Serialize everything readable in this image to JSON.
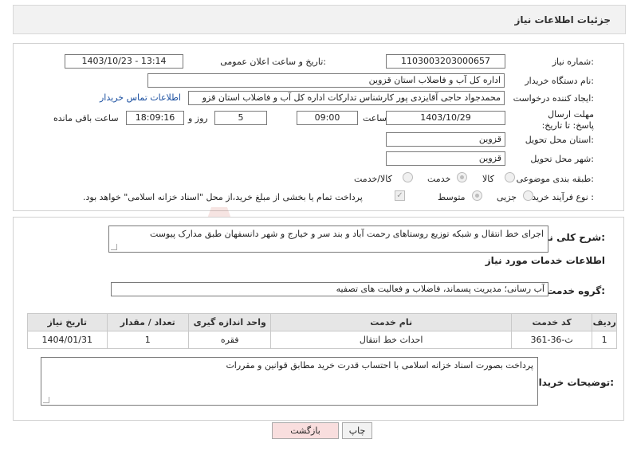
{
  "header": {
    "title": "جزئیات اطلاعات نیاز"
  },
  "form": {
    "need_number_label": "شماره نیاز:",
    "need_number": "1103003203000657",
    "announce_label": "تاریخ و ساعت اعلان عمومی:",
    "announce_value": "1403/10/23 - 13:14",
    "buyer_org_label": "نام دستگاه خریدار:",
    "buyer_org": "اداره کل آب و فاضلاب استان قزوین",
    "creator_label": "ایجاد کننده درخواست:",
    "creator": "محمدجواد حاجی آقایزدی پور کارشناس تدارکات اداره کل آب و فاضلاب استان قزو",
    "contact_link": "اطلاعات تماس خریدار",
    "deadline_label": "مهلت ارسال پاسخ: تا تاریخ:",
    "deadline_date": "1403/10/29",
    "time_label": "ساعت",
    "deadline_time": "09:00",
    "days_value": "5",
    "days_label": "روز و",
    "remaining_time": "18:09:16",
    "remaining_label": "ساعت باقی مانده",
    "province_label": "استان محل تحویل:",
    "province": "قزوین",
    "city_label": "شهر محل تحویل:",
    "city": "قزوین",
    "category_label": "طبقه بندی موضوعی:",
    "category_options": [
      "کالا",
      "خدمت",
      "کالا/خدمت"
    ],
    "category_selected": "خدمت",
    "process_label": "نوع فرآیند خرید :",
    "process_options": [
      "جزیی",
      "متوسط"
    ],
    "process_selected": "متوسط",
    "payment_note": "پرداخت تمام یا بخشی از مبلغ خرید،از محل \"اسناد خزانه اسلامی\" خواهد بود."
  },
  "details": {
    "summary_label": "شرح کلی نیاز:",
    "summary": "اجرای خط انتقال و شبکه توزیع روستاهای رحمت آباد و بند سر و خیارج و شهر دانسفهان طبق مدارک پیوست",
    "services_heading": "اطلاعات خدمات مورد نیاز",
    "service_group_label": "گروه خدمت:",
    "service_group": "آب رسانی؛ مدیریت پسماند، فاضلاب و فعالیت های تصفیه",
    "table": {
      "headers": [
        "ردیف",
        "کد خدمت",
        "نام خدمت",
        "واحد اندازه گیری",
        "تعداد / مقدار",
        "تاریخ نیاز"
      ],
      "rows": [
        [
          "1",
          "ث-36-361",
          "احداث خط انتقال",
          "فقره",
          "1",
          "1404/01/31"
        ]
      ]
    },
    "buyer_notes_label": "توضیحات خریدار:",
    "buyer_notes": "پرداخت بصورت اسناد خزانه اسلامی با احتساب قدرت خرید مطابق قوانین و مقررات"
  },
  "buttons": {
    "print": "چاپ",
    "back": "بازگشت"
  },
  "watermark": "AriaTender.net",
  "colors": {
    "link": "#1a4fa0",
    "back_button_bg": "#f9dede",
    "watermark": "#c0392b"
  }
}
